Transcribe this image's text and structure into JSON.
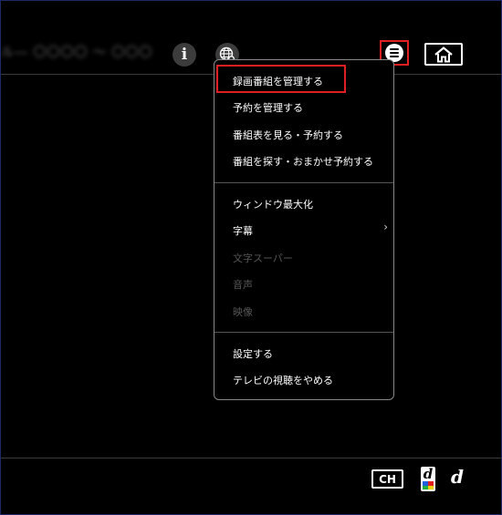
{
  "header": {
    "program_title_blurred": "ル― 〇〇〇〇 〜 〇〇〇",
    "info_icon": "info-icon",
    "globe_icon": "globe-search-icon",
    "menu_icon": "menu-list-icon",
    "home_icon": "home-icon",
    "info_glyph": "i"
  },
  "menu": {
    "group1": [
      {
        "label": "録画番組を管理する",
        "enabled": true,
        "highlighted": true
      },
      {
        "label": "予約を管理する",
        "enabled": true
      },
      {
        "label": "番組表を見る・予約する",
        "enabled": true
      },
      {
        "label": "番組を探す・おまかせ予約する",
        "enabled": true
      }
    ],
    "group2": [
      {
        "label": "ウィンドウ最大化",
        "enabled": true
      },
      {
        "label": "字幕",
        "enabled": true,
        "has_submenu": true,
        "chevron": "›"
      },
      {
        "label": "文字スーパー",
        "enabled": false
      },
      {
        "label": "音声",
        "enabled": false
      },
      {
        "label": "映像",
        "enabled": false
      }
    ],
    "group3": [
      {
        "label": "設定する",
        "enabled": true
      },
      {
        "label": "テレビの視聴をやめる",
        "enabled": true
      }
    ]
  },
  "footer": {
    "ch_label": "CH",
    "d_button_letter": "d",
    "d_plain_letter": "d"
  },
  "colors": {
    "background": "#000000",
    "highlight": "#e02020",
    "disabled_text": "#555555",
    "divider": "#3a3a3a"
  }
}
